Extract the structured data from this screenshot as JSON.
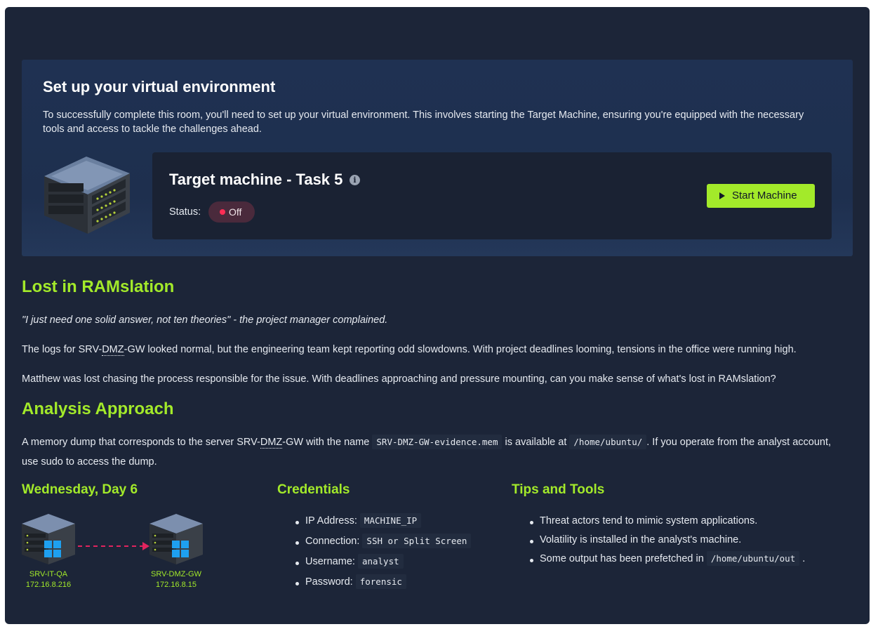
{
  "environment": {
    "title": "Set up your virtual environment",
    "description": "To successfully complete this room, you'll need to set up your virtual environment. This involves starting the Target Machine, ensuring you're equipped with the necessary tools and access to tackle the challenges ahead."
  },
  "machine": {
    "title": "Target machine - Task 5",
    "status_label": "Status:",
    "status_value": "Off",
    "start_label": "Start Machine",
    "status_color": "#ff2d55",
    "button_color": "#a3ea2a"
  },
  "intro": {
    "heading": "Lost in RAMslation",
    "quote": "\"I just need one solid answer, not ten theories\" - the project manager complained.",
    "p1_a": "The logs for SRV-",
    "p1_abbr": "DMZ",
    "p1_b": "-GW looked normal, but the engineering team kept reporting odd slowdowns. With project deadlines looming, tensions in the office were running high.",
    "p2": "Matthew was lost chasing the process responsible for the issue. With deadlines approaching and pressure mounting, can you make sense of what's lost in RAMslation?"
  },
  "approach": {
    "heading": "Analysis Approach",
    "t1": "A memory dump that corresponds to the server SRV-",
    "abbr": "DMZ",
    "t2": "-GW with the name ",
    "code1": "SRV-DMZ-GW-evidence.mem",
    "t3": " is available at ",
    "code2": "/home/ubuntu/",
    "t4": ". If you operate from the analyst account,",
    "line2": "use sudo to access the dump."
  },
  "day": {
    "heading": "Wednesday, Day 6",
    "source": {
      "name": "SRV-IT-QA",
      "ip": "172.16.8.216"
    },
    "target": {
      "name": "SRV-DMZ-GW",
      "ip": "172.16.8.15"
    }
  },
  "credentials": {
    "heading": "Credentials",
    "items": [
      {
        "label": "IP Address:",
        "value": "MACHINE_IP"
      },
      {
        "label": "Connection:",
        "value": "SSH or Split Screen"
      },
      {
        "label": "Username:",
        "value": "analyst"
      },
      {
        "label": "Password:",
        "value": "forensic"
      }
    ]
  },
  "tips": {
    "heading": "Tips and Tools",
    "item1": "Threat actors tend to mimic system applications.",
    "item2": "Volatility is installed in the analyst's machine.",
    "item3_text": "Some output has been prefetched in ",
    "item3_code": "/home/ubuntu/out",
    "item3_end": "."
  }
}
